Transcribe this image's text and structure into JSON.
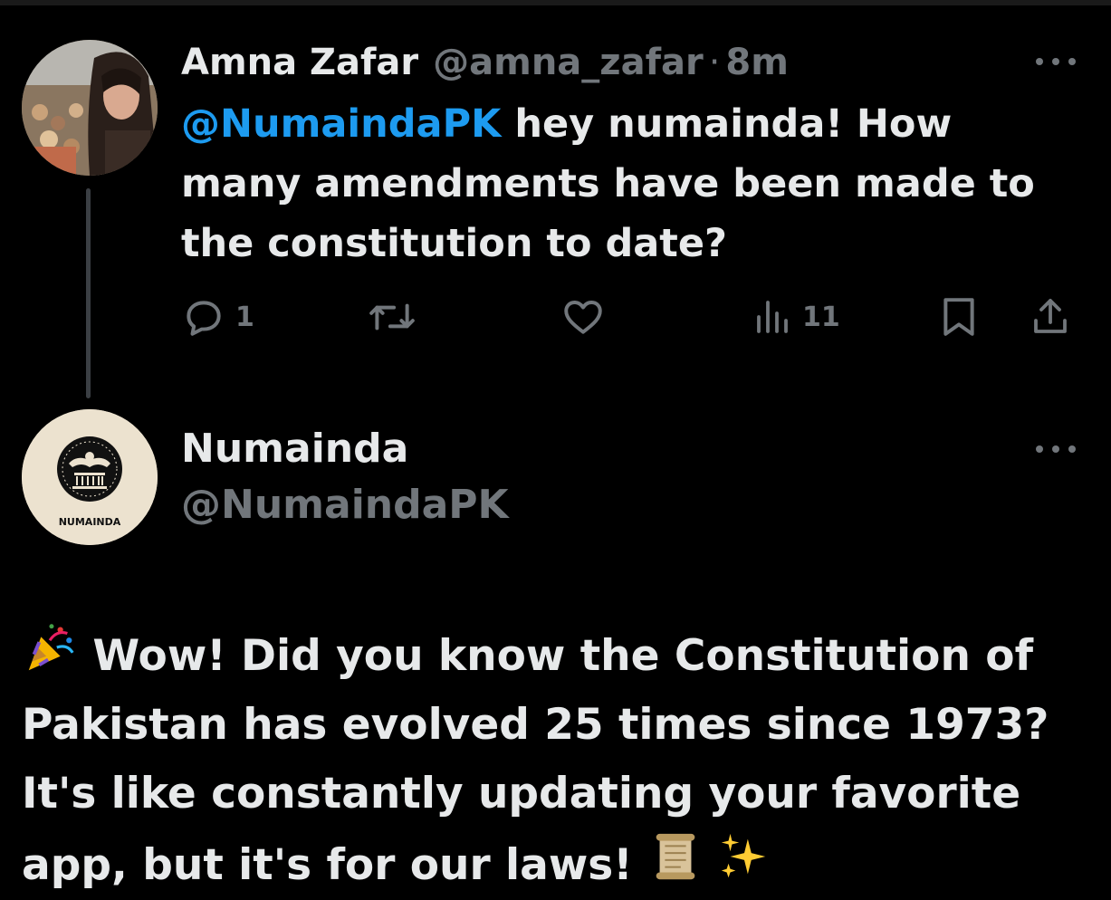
{
  "tweet1": {
    "author_name": "Amna Zafar",
    "author_handle": "@amna_zafar",
    "separator": "·",
    "time": "8m",
    "mention": "@NumaindaPK",
    "text_line1_rest": " hey numainda! How",
    "text_line2": "many amendments have been made to",
    "text_line3": "the constitution to date?",
    "actions": {
      "reply_icon": "reply-icon",
      "reply_count": "1",
      "retweet_icon": "retweet-icon",
      "like_icon": "heart-icon",
      "views_icon": "views-icon",
      "views_count": "11",
      "bookmark_icon": "bookmark-icon",
      "share_icon": "share-icon"
    }
  },
  "tweet2": {
    "author_name": "Numainda",
    "author_handle": "@NumaindaPK",
    "avatar_text": "NUMAINDA",
    "text_line1": " Wow! Did you know the Constitution of",
    "text_line2": "Pakistan has evolved 25 times since 1973?",
    "text_line3": "It's like constantly updating your favorite",
    "text_line4": "app, but it's for our laws! ",
    "emoji_start": "party-popper-emoji",
    "emoji_scroll": "scroll-emoji",
    "emoji_sparkles": "sparkles-emoji"
  },
  "colors": {
    "background": "#000000",
    "text": "#e7e9ea",
    "secondary": "#71767b",
    "link": "#1d9bf0"
  }
}
